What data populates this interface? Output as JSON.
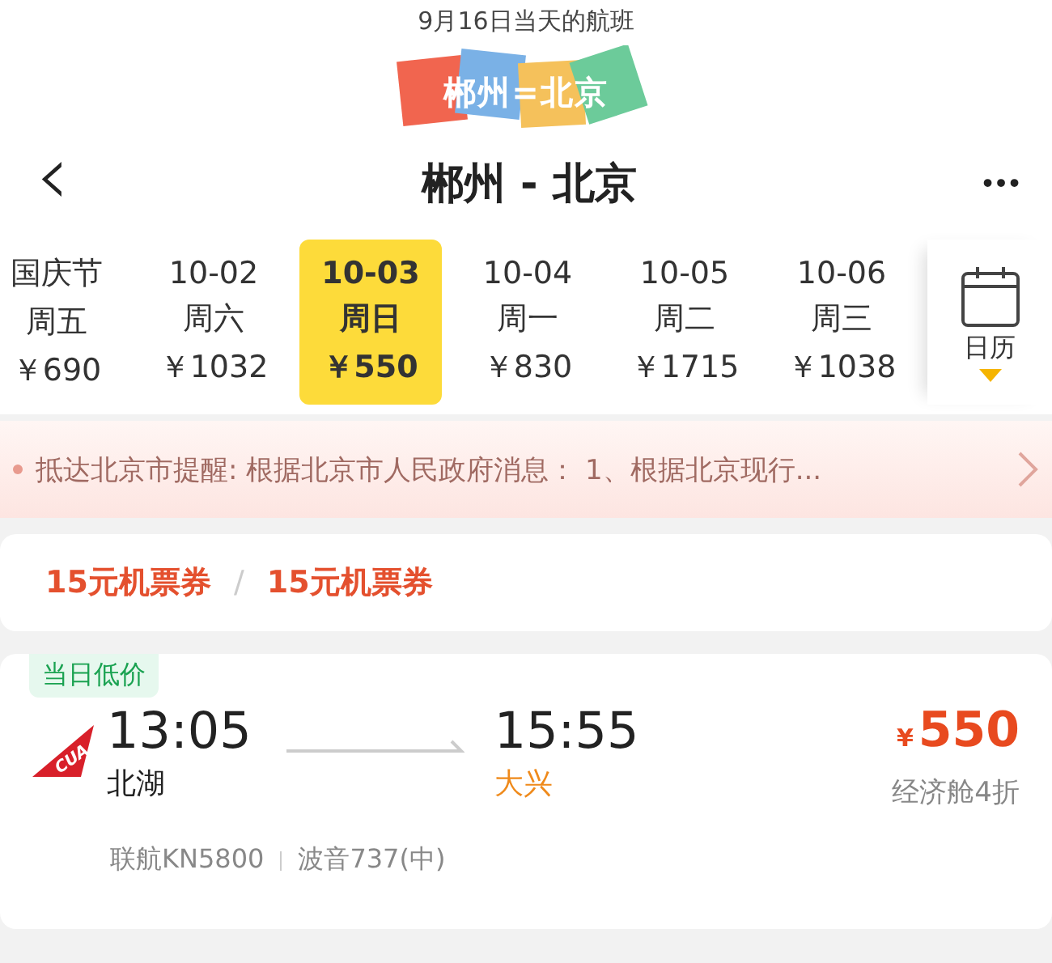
{
  "caption": "9月16日当天的航班",
  "banner_title": "郴州=北京",
  "header": {
    "back": "‹",
    "title": "郴州 - 北京",
    "more": "•••"
  },
  "dates": [
    {
      "label": "国庆节",
      "weekday": "周五",
      "price": "￥690",
      "selected": false
    },
    {
      "label": "10-02",
      "weekday": "周六",
      "price": "￥1032",
      "selected": false
    },
    {
      "label": "10-03",
      "weekday": "周日",
      "price": "￥550",
      "selected": true
    },
    {
      "label": "10-04",
      "weekday": "周一",
      "price": "￥830",
      "selected": false
    },
    {
      "label": "10-05",
      "weekday": "周二",
      "price": "￥1715",
      "selected": false
    },
    {
      "label": "10-06",
      "weekday": "周三",
      "price": "￥1038",
      "selected": false
    }
  ],
  "calendar_button": "日历",
  "notice": "抵达北京市提醒: 根据北京市人民政府消息： 1、根据北京现行...",
  "coupons": [
    "15元机票券",
    "15元机票券"
  ],
  "coupon_separator": "/",
  "flight": {
    "tag": "当日低价",
    "logo_text": "CUA",
    "depart_time": "13:05",
    "depart_airport": "北湖",
    "arrive_time": "15:55",
    "arrive_airport": "大兴",
    "currency": "¥",
    "price": "550",
    "cabin": "经济舱4折",
    "flight_no": "联航KN5800",
    "aircraft": "波音737(中)"
  }
}
